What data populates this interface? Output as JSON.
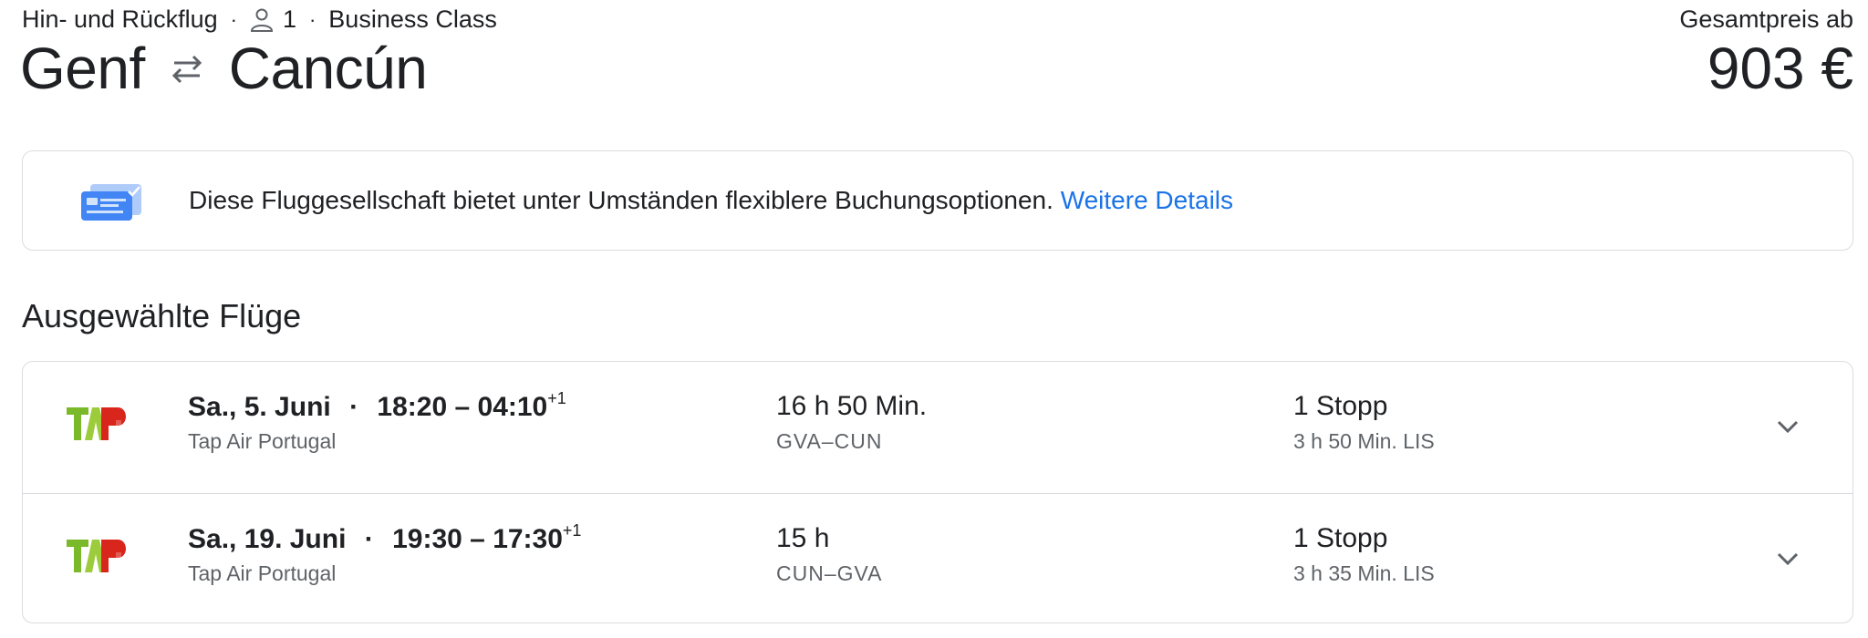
{
  "header": {
    "trip_type": "Hin- und Rückflug",
    "passengers": "1",
    "cabin_class": "Business Class",
    "origin": "Genf",
    "destination": "Cancún",
    "price_label": "Gesamtpreis ab",
    "price": "903 €"
  },
  "notice": {
    "text": "Diese Fluggesellschaft bietet unter Umständen flexiblere Buchungsoptionen.",
    "link": "Weitere Details",
    "icon": "booking-options-icon"
  },
  "selected_flights": {
    "title": "Ausgewählte Flüge",
    "flights": [
      {
        "date": "Sa., 5. Juni",
        "times": "18:20 – 04:10",
        "day_offset": "+1",
        "airline": "Tap Air Portugal",
        "duration": "16 h 50 Min.",
        "route": "GVA–CUN",
        "stops": "1 Stopp",
        "layover": "3 h 50 Min. LIS"
      },
      {
        "date": "Sa., 19. Juni",
        "times": "19:30 – 17:30",
        "day_offset": "+1",
        "airline": "Tap Air Portugal",
        "duration": "15 h",
        "route": "CUN–GVA",
        "stops": "1 Stopp",
        "layover": "3 h 35 Min. LIS"
      }
    ]
  },
  "colors": {
    "link": "#1a73e8",
    "secondary_text": "#5f6368",
    "border": "#dadce0",
    "tap_green": "#7ab929",
    "tap_red": "#d9261c"
  }
}
